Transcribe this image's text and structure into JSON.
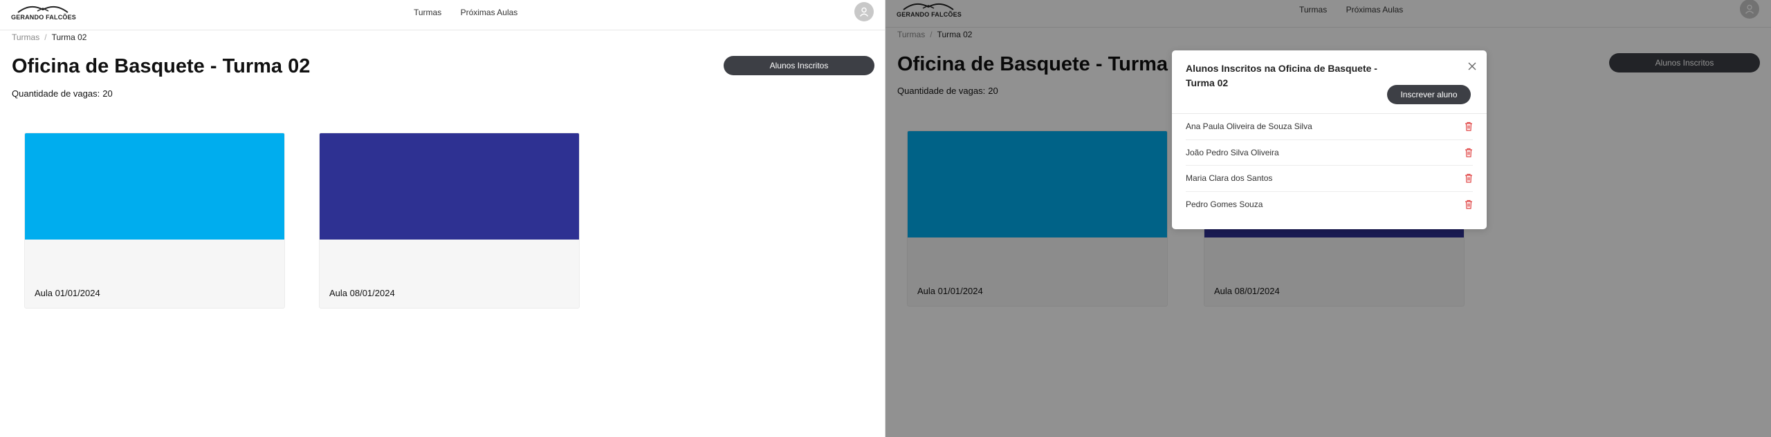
{
  "app": {
    "logo_text": "GERANDO FALCÕES",
    "nav": [
      "Turmas",
      "Próximas Aulas"
    ]
  },
  "breadcrumb": {
    "parent": "Turmas",
    "separator": "/",
    "current": "Turma 02"
  },
  "page": {
    "title": "Oficina de Basquete - Turma 02",
    "vagas_label": "Quantidade de vagas:",
    "vagas_value": "20",
    "alunos_button": "Alunos Inscritos"
  },
  "cards": [
    {
      "caption": "Aula 01/01/2024",
      "color": "#00adee"
    },
    {
      "caption": "Aula 08/01/2024",
      "color": "#2e3192"
    }
  ],
  "modal": {
    "title": "Alunos Inscritos na Oficina de Basquete - Turma 02",
    "inscrever_button": "Inscrever aluno",
    "students": [
      "Ana Paula Oliveira de Souza Silva",
      "João Pedro Silva Oliveira",
      "Maria Clara dos Santos",
      "Pedro Gomes Souza"
    ]
  },
  "colors": {
    "primary_button": "#3d3f45",
    "delete_icon": "#e04545",
    "overlay": "rgba(0,0,0,0.43)"
  },
  "icons": [
    "user-icon",
    "close-icon",
    "trash-icon",
    "falcon-logo-icon"
  ]
}
